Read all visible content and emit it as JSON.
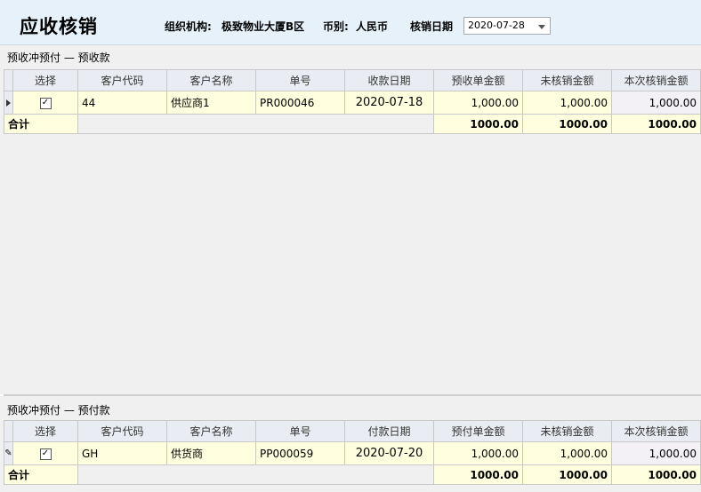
{
  "header": {
    "title": "应收核销",
    "org_label": "组织机构:",
    "org_value": "极致物业大厦B区",
    "currency_label": "币别:",
    "currency_value": "人民币",
    "date_label": "核销日期",
    "date_value": "2020-07-28"
  },
  "top_section": {
    "label": "预收冲预付 — 预收款",
    "columns": [
      "选择",
      "客户代码",
      "客户名称",
      "单号",
      "收款日期",
      "预收单金额",
      "未核销金额",
      "本次核销金额"
    ],
    "rows": [
      {
        "code": "44",
        "name": "供应商1",
        "doc": "PR000046",
        "date": "2020-07-18",
        "amount": "1,000.00",
        "unsettled": "1,000.00",
        "current": "1,000.00"
      }
    ],
    "total": {
      "label": "合计",
      "amount": "1000.00",
      "unsettled": "1000.00",
      "current": "1000.00"
    }
  },
  "bottom_section": {
    "label": "预收冲预付 — 预付款",
    "columns": [
      "选择",
      "客户代码",
      "客户名称",
      "单号",
      "付款日期",
      "预付单金额",
      "未核销金额",
      "本次核销金额"
    ],
    "rows": [
      {
        "code": "GH",
        "name": "供货商",
        "doc": "PP000059",
        "date": "2020-07-20",
        "amount": "1,000.00",
        "unsettled": "1,000.00",
        "current": "1,000.00"
      }
    ],
    "total": {
      "label": "合计",
      "amount": "1000.00",
      "unsettled": "1000.00",
      "current": "1000.00"
    }
  }
}
